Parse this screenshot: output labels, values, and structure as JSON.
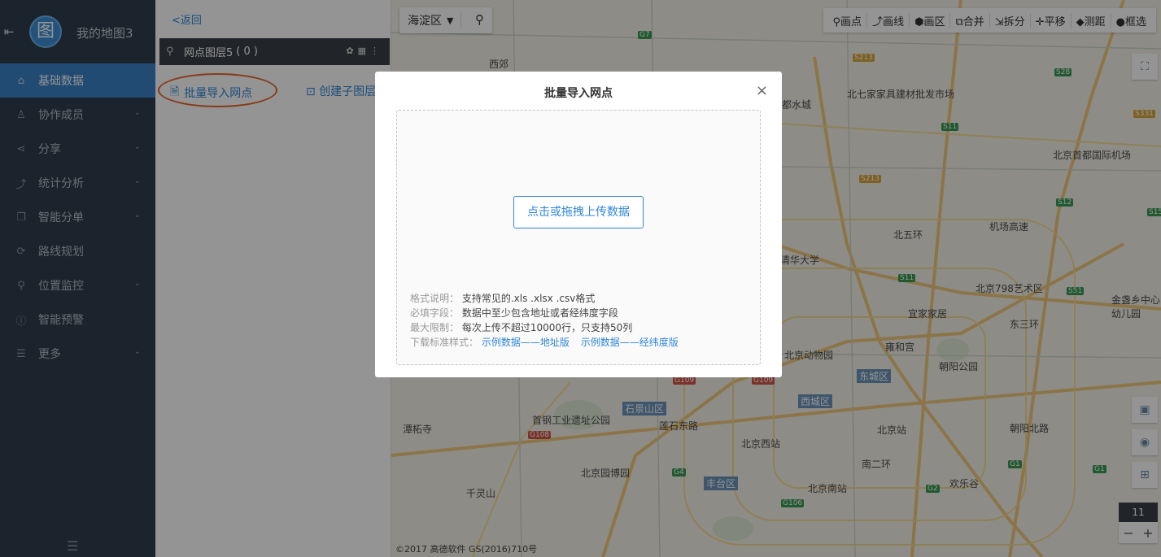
{
  "sidebar": {
    "logout_icon": "logout-icon",
    "logo_glyph": "图",
    "map_title": "我的地图3",
    "items": [
      {
        "label": "基础数据",
        "icon": "home-icon",
        "has_chevron": false,
        "active": true
      },
      {
        "label": "协作成员",
        "icon": "user-icon",
        "has_chevron": true
      },
      {
        "label": "分享",
        "icon": "share-icon",
        "has_chevron": true
      },
      {
        "label": "统计分析",
        "icon": "chart-icon",
        "has_chevron": true
      },
      {
        "label": "智能分单",
        "icon": "copy-icon",
        "has_chevron": true
      },
      {
        "label": "路线规划",
        "icon": "route-icon",
        "has_chevron": false
      },
      {
        "label": "位置监控",
        "icon": "location-icon",
        "has_chevron": true
      },
      {
        "label": "智能预警",
        "icon": "info-icon",
        "has_chevron": false
      },
      {
        "label": "更多",
        "icon": "list-icon",
        "has_chevron": true
      }
    ],
    "chevron": "⌄",
    "collapse_icon": "☰"
  },
  "panel": {
    "back_label": "<返回",
    "layer_name": "网点图层5",
    "layer_count": "( 0 )",
    "import_label": "批量导入网点",
    "create_sublayer_label": "创建子图层"
  },
  "map": {
    "district": "海淀区",
    "tools": [
      "画点",
      "画线",
      "画区",
      "合并",
      "拆分",
      "平移",
      "测距",
      "框选"
    ],
    "tool_glyphs": [
      "⚲",
      "⤴",
      "⬢",
      "⧉",
      "⇲",
      "✛",
      "◆",
      "●"
    ],
    "copyright": "©2017 高德软件 GS(2016)710号",
    "zoom_level": "11",
    "zoom_out": "−",
    "zoom_in": "+",
    "labels": [
      "北七家家具建材批发市场",
      "北京首都国际机场",
      "北京798艺术区",
      "宜家家居",
      "雍和宫",
      "朝阳公园",
      "北京动物园",
      "东城区",
      "西城区",
      "石景山区",
      "首钢工业遗址公园",
      "北京园博园",
      "北京西站",
      "北京站",
      "北京南站",
      "丰台区",
      "欢乐谷",
      "千灵山",
      "潭柘寺",
      "莲石东路",
      "南二环",
      "清华大学",
      "机场高速",
      "北五环",
      "金盏乡中心幼儿园",
      "东三环",
      "西郊",
      "都水城",
      "朝阳北路"
    ],
    "shields": [
      "G7",
      "S213",
      "S28",
      "S331",
      "S11",
      "S12",
      "S15",
      "S213",
      "G109",
      "G109",
      "G108",
      "G4",
      "G106",
      "G2",
      "G1",
      "G1",
      "S51",
      "S11"
    ]
  },
  "modal": {
    "title": "批量导入网点",
    "close_glyph": "×",
    "upload_label": "点击或拖拽上传数据",
    "format_key": "格式说明：",
    "format_val": "支持常见的.xls .xlsx .csv格式",
    "required_key": "必填字段：",
    "required_val": "数据中至少包含地址或者经纬度字段",
    "limit_key": "最大限制：",
    "limit_val": "每次上传不超过10000行，只支持50列",
    "download_key": "下载标准样式：",
    "link_address": "示例数据——地址版",
    "link_latlng": "示例数据——经纬度版"
  }
}
